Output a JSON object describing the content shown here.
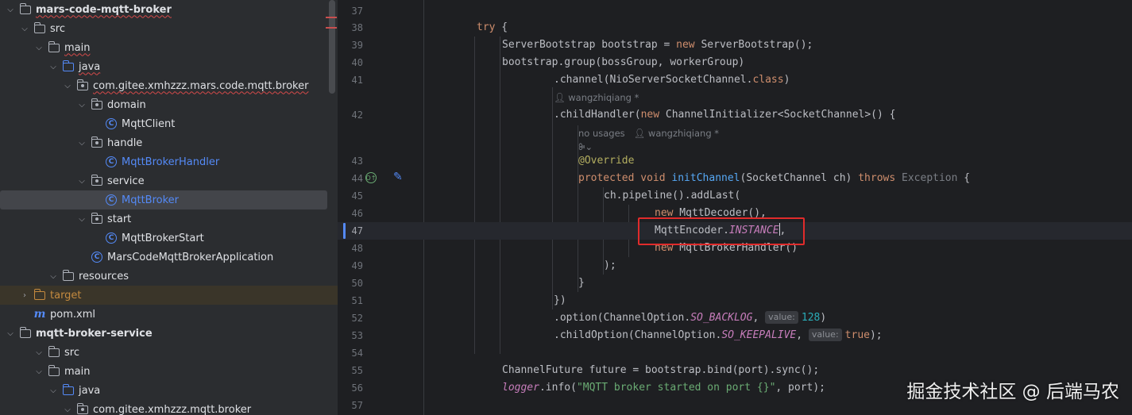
{
  "tree": {
    "items": [
      {
        "label": "mars-code-mqtt-broker"
      },
      {
        "label": "src"
      },
      {
        "label": "main"
      },
      {
        "label": "java"
      },
      {
        "label": "com.gitee.xmhzzz.mars.code.mqtt.broker"
      },
      {
        "label": "domain"
      },
      {
        "label": "MqttClient"
      },
      {
        "label": "handle"
      },
      {
        "label": "MqttBrokerHandler"
      },
      {
        "label": "service"
      },
      {
        "label": "MqttBroker"
      },
      {
        "label": "start"
      },
      {
        "label": "MqttBrokerStart"
      },
      {
        "label": "MarsCodeMqttBrokerApplication"
      },
      {
        "label": "resources"
      },
      {
        "label": "target"
      },
      {
        "label": "pom.xml"
      },
      {
        "label": "mqtt-broker-service"
      },
      {
        "label": "src"
      },
      {
        "label": "main"
      },
      {
        "label": "java"
      },
      {
        "label": "com.gitee.xmhzzz.mqtt.broker"
      }
    ],
    "icons": {
      "folder": "folder-icon",
      "package": "package-icon",
      "class": "class-icon",
      "maven": "maven-icon"
    }
  },
  "editor": {
    "line_numbers": [
      "37",
      "38",
      "39",
      "40",
      "41",
      "42",
      "43",
      "44",
      "45",
      "46",
      "47",
      "48",
      "49",
      "50",
      "51",
      "52",
      "53",
      "54",
      "55",
      "56",
      "57"
    ],
    "current_line": "47",
    "lines": {
      "l38": {
        "kw": "try",
        "rest": " {"
      },
      "l39": {
        "type": "ServerBootstrap bootstrap = ",
        "kw": "new",
        "rest": " ServerBootstrap();"
      },
      "l40": {
        "text": "bootstrap.group(bossGroup, workerGroup)"
      },
      "l41": {
        "a": ".channel(NioServerSocketChannel.",
        "kw": "class",
        "b": ")"
      },
      "l41_author": "wangzhiqiang *",
      "l42": {
        "a": ".childHandler(",
        "kw": "new",
        "b": " ChannelInitializer<SocketChannel>() {"
      },
      "l42_usages": "no usages",
      "l42_author": "wangzhiqiang *",
      "l42_ai": "ꔭ⌄",
      "l43": {
        "an": "@Override"
      },
      "l44": {
        "kw1": "protected void ",
        "fn": "initChannel",
        "a": "(SocketChannel ch) ",
        "kw2": "throws",
        "gr": " Exception",
        "b": " {"
      },
      "l45": {
        "text": "ch.pipeline().addLast("
      },
      "l46": {
        "kw": "new",
        "rest": " MqttDecoder(),"
      },
      "l47": {
        "a": "MqttEncoder.",
        "it": "INSTANCE",
        "b": ","
      },
      "l48": {
        "kw": "new",
        "rest": " MqttBrokerHandler()"
      },
      "l49": {
        "text": ");"
      },
      "l50": {
        "text": "}"
      },
      "l51": {
        "text": "})"
      },
      "l52": {
        "a": ".option(ChannelOption.",
        "it": "SO_BACKLOG",
        "b": ", ",
        "hint": "value:",
        "nm": "128",
        "c": ")"
      },
      "l53": {
        "a": ".childOption(ChannelOption.",
        "it": "SO_KEEPALIVE",
        "b": ", ",
        "hint": "value:",
        "kw": "true",
        "c": ");"
      },
      "l55": {
        "text": "ChannelFuture future = bootstrap.bind(port).sync();"
      },
      "l56": {
        "it": "logger",
        "a": ".info(",
        "st": "\"MQTT broker started on port {}\"",
        "b": ", port);"
      }
    }
  },
  "watermark": "掘金技术社区 @ 后端马农",
  "colors": {
    "highlight_box": "#e02b2b",
    "keyword": "#cf8e6d",
    "function": "#56a8f5",
    "static_field": "#c77dbb",
    "string": "#6aab73",
    "number": "#2aacb8"
  }
}
